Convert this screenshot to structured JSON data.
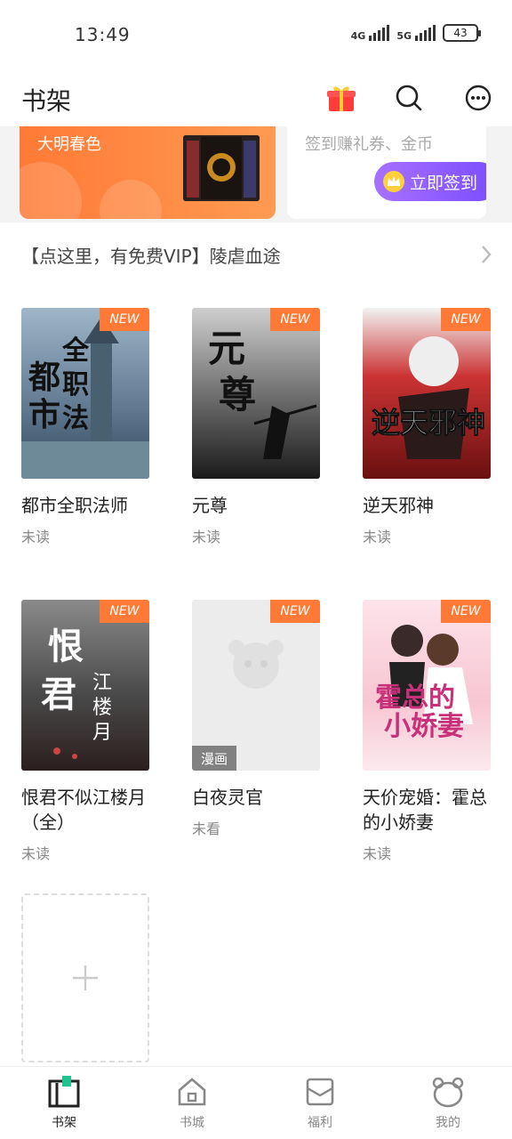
{
  "status_bar": {
    "time": "13:49",
    "net1": "4G",
    "net2": "5G",
    "battery": "43"
  },
  "header": {
    "title": "书架"
  },
  "banner": {
    "left_title": "大明春色",
    "right_text": "签到赚礼券、金币",
    "signin_label": "立即签到"
  },
  "promo": {
    "text": "【点这里，有免费VIP】陵虐血途"
  },
  "books": [
    {
      "title": "都市全职法师",
      "status": "未读",
      "badge": "NEW",
      "cover_text": "都市全职法师"
    },
    {
      "title": "元尊",
      "status": "未读",
      "badge": "NEW",
      "cover_text": "元尊"
    },
    {
      "title": "逆天邪神",
      "status": "未读",
      "badge": "NEW",
      "cover_text": "逆天邪神"
    },
    {
      "title": "恨君不似江楼月（全）",
      "status": "未读",
      "badge": "NEW",
      "cover_text": "恨君不似江楼月"
    },
    {
      "title": "白夜灵官",
      "status": "未看",
      "badge": "NEW",
      "tag": "漫画"
    },
    {
      "title": "天价宠婚：霍总的小娇妻",
      "status": "未读",
      "badge": "NEW",
      "cover_text": "霍总的小娇妻"
    }
  ],
  "nav": [
    {
      "label": "书架"
    },
    {
      "label": "书城"
    },
    {
      "label": "福利"
    },
    {
      "label": "我的"
    }
  ],
  "colors": {
    "accent": "#ff7a36",
    "signin": "#8a5cff",
    "active_nav": "#1fc38f"
  }
}
